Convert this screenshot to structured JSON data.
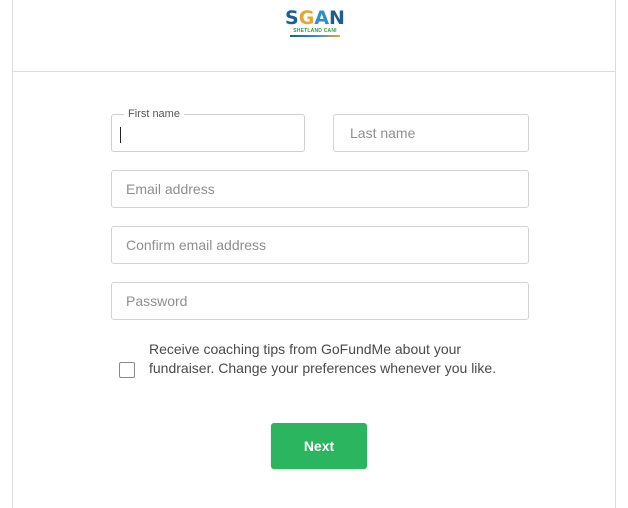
{
  "logo": {
    "letters": [
      "S",
      "G",
      "A",
      "N"
    ],
    "subtitle": "SHETLAND CANI"
  },
  "form": {
    "first_name": {
      "label": "First name",
      "value": ""
    },
    "last_name": {
      "placeholder": "Last name"
    },
    "email": {
      "placeholder": "Email address"
    },
    "confirm_email": {
      "placeholder": "Confirm email address"
    },
    "password": {
      "placeholder": "Password"
    },
    "opt_in": {
      "checked": false,
      "text": "Receive coaching tips from GoFundMe about your fundraiser. Change your preferences whenever you like."
    },
    "next_label": "Next"
  },
  "colors": {
    "button": "#2ab55e",
    "logo_blue": "#1b5e93",
    "logo_gold": "#e7a531"
  }
}
